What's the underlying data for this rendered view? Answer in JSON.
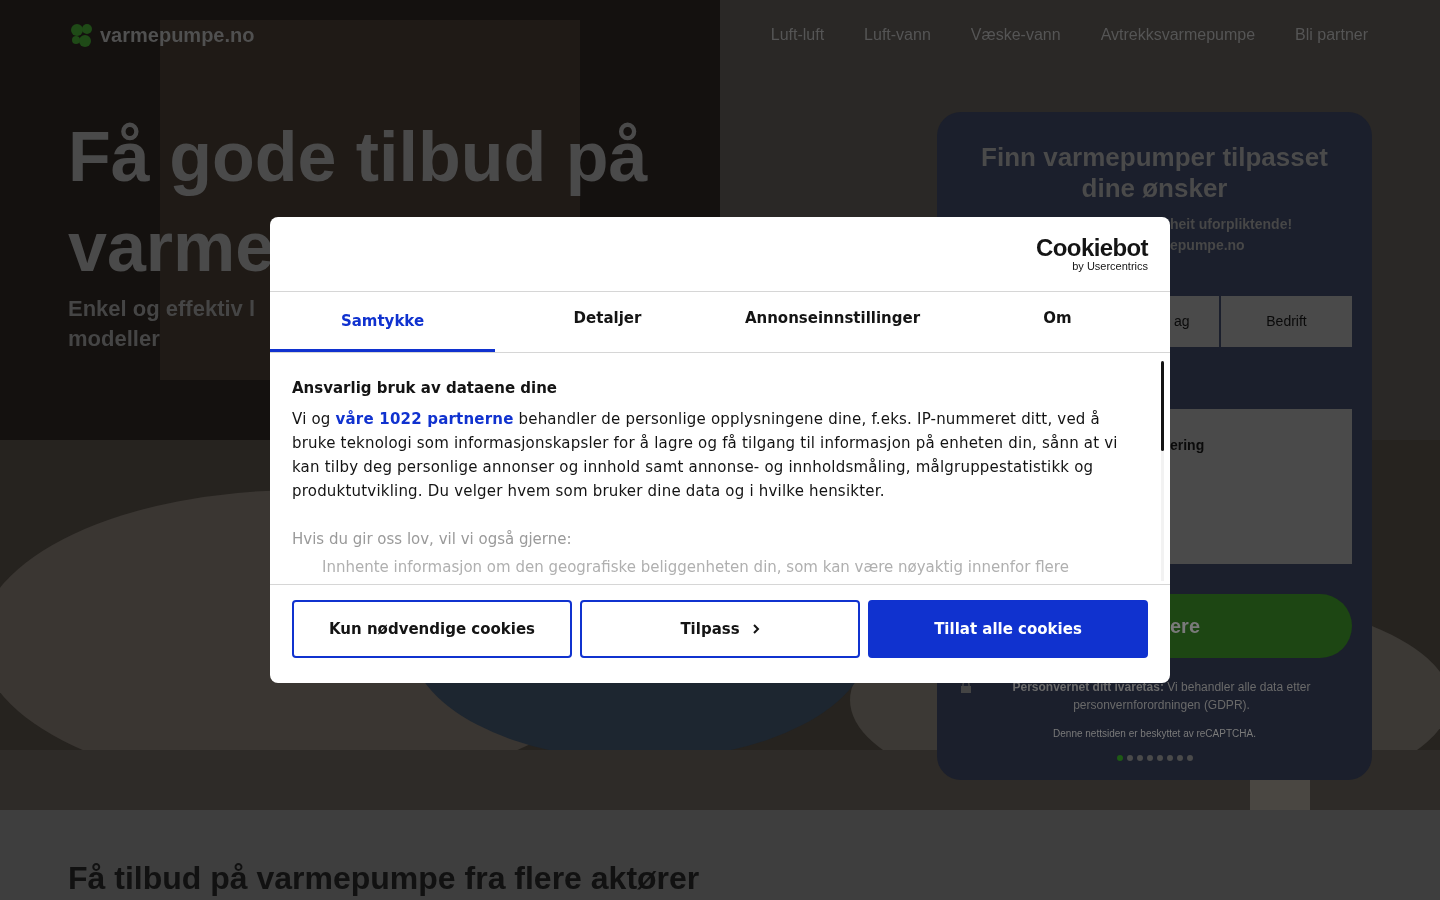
{
  "header": {
    "logo": "varmepumpe.no",
    "nav": [
      "Luft-luft",
      "Luft-vann",
      "Væske-vann",
      "Avtrekksvarmepumpe",
      "Bli partner"
    ]
  },
  "hero": {
    "kind": "picture",
    "title_lines": [
      "Få gode tilbud på",
      "varme"
    ],
    "subtitle_lines": [
      "Enkel og effektiv l",
      "modeller"
    ]
  },
  "form_card": {
    "title": "Finn varmepumper tilpasset dine ønsker",
    "subtitle_lines": [
      "heit uforpliktende!",
      "epumpe.no"
    ],
    "tabs": [
      {
        "label": "ag",
        "selected": false
      },
      {
        "label": "Bedrift",
        "selected": false
      }
    ],
    "field_label": "ering",
    "submit": "ere",
    "privacy_bold": "Personvernet ditt ivaretas:",
    "privacy_text": "Vi behandler alle data etter personvernforordningen (GDPR).",
    "recaptcha": "Denne nettsiden er beskyttet av reCAPTCHA.",
    "steps": [
      {
        "selected": true
      },
      {
        "selected": false
      },
      {
        "selected": false
      },
      {
        "selected": false
      },
      {
        "selected": false
      },
      {
        "selected": false
      },
      {
        "selected": false
      },
      {
        "selected": false
      }
    ]
  },
  "section": {
    "heading": "Få tilbud på varmepumpe fra flere aktører"
  },
  "cookie_dialog": {
    "logo": "Cookiebot",
    "logo_sub": "by Usercentrics",
    "tabs": [
      {
        "label": "Samtykke",
        "selected": true
      },
      {
        "label": "Detaljer",
        "selected": false
      },
      {
        "label": "Annonseinnstillinger",
        "selected": false
      },
      {
        "label": "Om",
        "selected": false
      }
    ],
    "heading": "Ansvarlig bruk av dataene dine",
    "paragraph_before": "Vi og",
    "paragraph_link": "våre 1022 partnerne",
    "paragraph_after": "behandler de personlige opplysningene dine, f.eks. IP-nummeret ditt, ved å bruke teknologi som informasjonskapsler for å lagre og få tilgang til informasjon på enheten din, sånn at vi kan tilby deg personlige annonser og innhold samt annonse- og innholdsmåling, målgruppestatistikk og produktutvikling. Du velger hvem som bruker dine data og i hvilke hensikter.",
    "subheading": "Hvis du gir oss lov, vil vi også gjerne:",
    "list_item": "Innhente informasjon om den geografiske beliggenheten din, som kan være nøyaktig innenfor flere",
    "buttons": [
      {
        "label": "Kun nødvendige cookies",
        "kind": "outline"
      },
      {
        "label": "Tilpass",
        "kind": "outline-chevron"
      },
      {
        "label": "Tillat alle cookies",
        "kind": "primary"
      }
    ]
  }
}
